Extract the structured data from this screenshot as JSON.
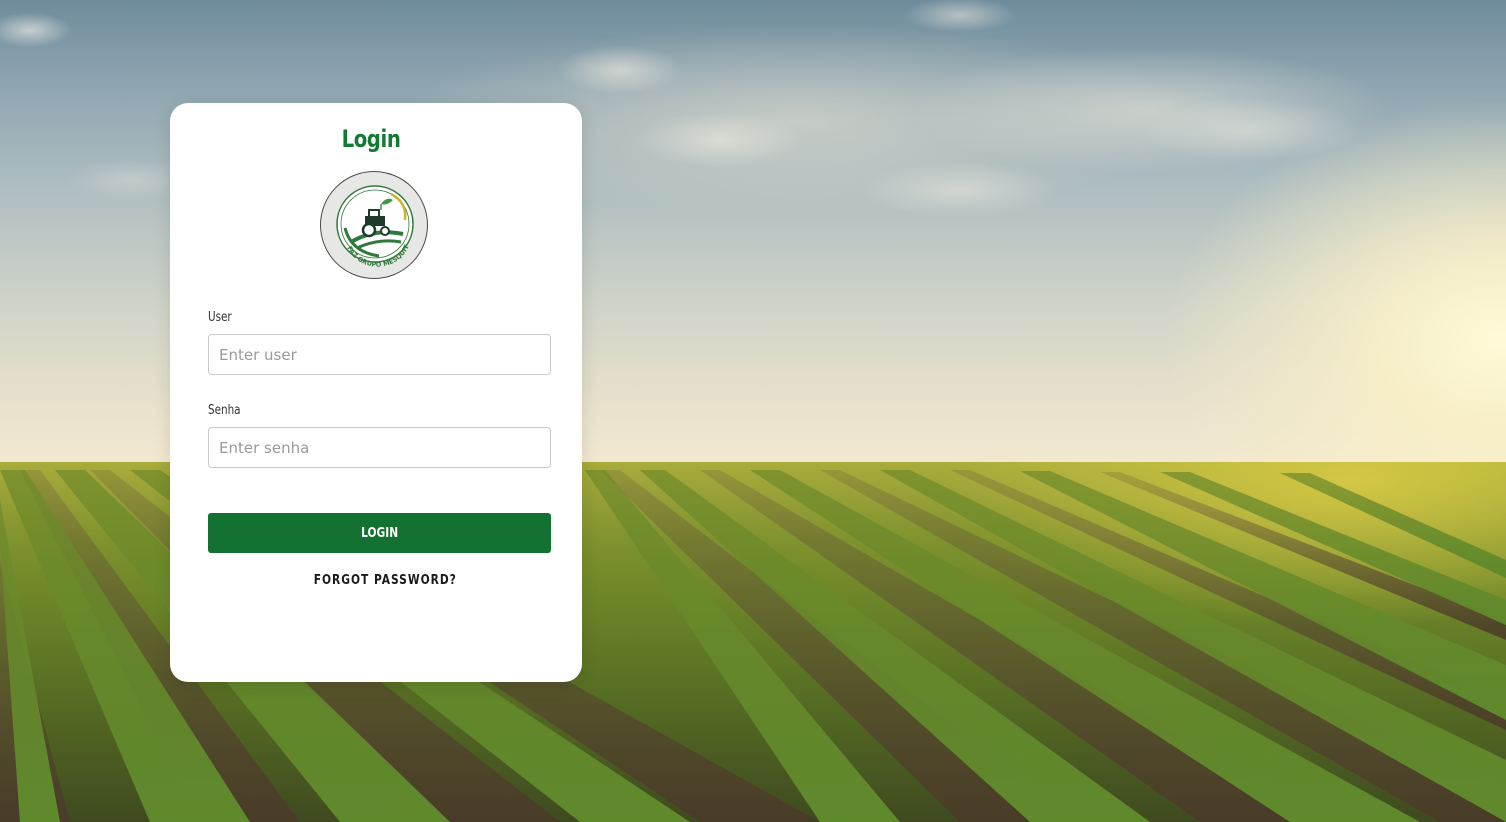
{
  "login": {
    "title": "Login",
    "logo_text": "FAZ GRUPO MESQUITA",
    "user": {
      "label": "User",
      "placeholder": "Enter user",
      "value": ""
    },
    "password": {
      "label": "Senha",
      "placeholder": "Enter senha",
      "value": ""
    },
    "submit_label": "LOGIN",
    "forgot_label": "FORGOT PASSWORD?"
  },
  "colors": {
    "brand_green": "#137a33",
    "button_green": "#137231",
    "card_bg": "#ffffff"
  },
  "icons": [
    "tractor-logo-icon",
    "leaf-icon"
  ]
}
